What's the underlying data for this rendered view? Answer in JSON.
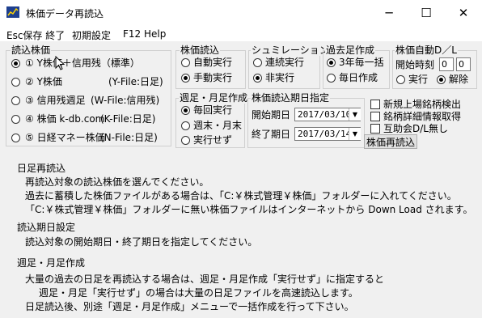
{
  "window": {
    "title": "株価データ再読込",
    "minimize": "─",
    "maximize": "☐",
    "close": "✕"
  },
  "menu": {
    "items": [
      "Esc保存 終了",
      "初期設定",
      "F12 Help"
    ]
  },
  "stock_group": {
    "label": "読込株価",
    "options": [
      {
        "text": "① Y株価＋信用残（標準）",
        "selected": true
      },
      {
        "text": "② Y株価",
        "file": "(Y-File:日足)",
        "selected": false
      },
      {
        "text": "③ 信用残週足",
        "file": "(W-File:信用残)",
        "selected": false
      },
      {
        "text": "④ 株価 k-db.com",
        "file": "(K-File:日足)",
        "selected": false
      },
      {
        "text": "⑤ 日経マネー株価",
        "file": "(N-File:日足)",
        "selected": false
      }
    ]
  },
  "load_group": {
    "label": "株価読込",
    "options": [
      {
        "text": "自動実行",
        "selected": false
      },
      {
        "text": "手動実行",
        "selected": true
      }
    ]
  },
  "sim_group": {
    "label": "シュミレーション",
    "options": [
      {
        "text": "連続実行",
        "selected": false
      },
      {
        "text": "非実行",
        "selected": true
      }
    ]
  },
  "past_group": {
    "label": "過去足作成",
    "options": [
      {
        "text": "3年毎一括",
        "selected": true
      },
      {
        "text": "毎日作成",
        "selected": false
      }
    ]
  },
  "auto_group": {
    "label": "株価自動D／L",
    "start_label": "開始時刻",
    "hour": "0",
    "minute": "0",
    "options": [
      {
        "text": "実行",
        "selected": false
      },
      {
        "text": "解除",
        "selected": true
      }
    ]
  },
  "weekly_group": {
    "label": "週足・月足作成",
    "options": [
      {
        "text": "毎回実行",
        "selected": true
      },
      {
        "text": "週末・月末",
        "selected": false
      },
      {
        "text": "実行せず",
        "selected": false
      }
    ]
  },
  "period_group": {
    "label": "株価読込期日指定",
    "start_label": "開始期日",
    "start_value": "2017/03/10",
    "end_label": "終了期日",
    "end_value": "2017/03/14"
  },
  "checks": [
    {
      "text": "新規上場銘柄検出",
      "checked": false
    },
    {
      "text": "銘柄詳細情報取得",
      "checked": false
    },
    {
      "text": "互助会D/L無し",
      "checked": false
    }
  ],
  "reload_button": "株価再読込",
  "help": {
    "lines": [
      "日足再読込",
      "再読込対象の読込株価を選んでください。",
      "過去に蓄積した株価ファイルがある場合は、「C:￥株式管理￥株価」フォルダーに入れてください。",
      "「C:￥株式管理￥株価」フォルダーに無い株価ファイルはインターネットから Down Load されます。",
      "読込期日設定",
      "読込対象の開始期日・終了期日を指定してください。",
      "週足・月足作成",
      "大量の過去の日足を再読込する場合は、週足・月足作成「実行せず」に指定すると",
      "週足・月足「実行せず」の場合は大量の日足ファイルを高速読込します。",
      "日足読込後、別途「週足・月足作成」メニューで一括作成を行って下さい。"
    ]
  }
}
